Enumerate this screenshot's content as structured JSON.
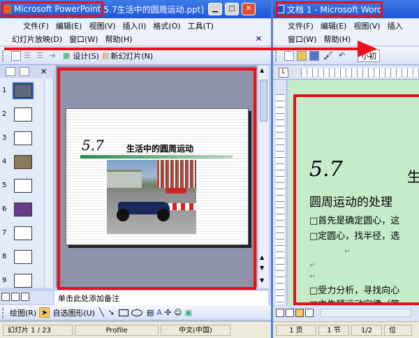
{
  "ppt": {
    "app_title": "Microsoft PowerPoint",
    "doc_title": "5.7生活中的圆周运动.ppt]",
    "menu_row1": [
      "文件(F)",
      "编辑(E)",
      "视图(V)",
      "插入(I)",
      "格式(O)",
      "工具(T)"
    ],
    "menu_row2": [
      "幻灯片放映(D)",
      "窗口(W)",
      "帮助(H)"
    ],
    "toolbar": {
      "design": "设计(S)",
      "new_slide": "新幻灯片(N)"
    },
    "slide_numbers": [
      "1",
      "2",
      "3",
      "4",
      "5",
      "6",
      "7",
      "8",
      "9"
    ],
    "slide": {
      "number": "5.7",
      "title": "生活中的圆周运动"
    },
    "notes_placeholder": "单击此处添加备注",
    "drawing": {
      "draw": "绘图(R)",
      "autoshape": "自选图形(U)"
    },
    "status": {
      "slide_pos": "幻灯片 1 / 23",
      "template": "Profile",
      "language": "中文(中国)"
    }
  },
  "word": {
    "title": "文档 1 - Microsoft Word",
    "menu_row1": [
      "文件(F)",
      "编辑(E)",
      "视图(V)",
      "插入"
    ],
    "menu_row2": [
      "窗口(W)",
      "帮助(H)"
    ],
    "font_size": "小初",
    "doc": {
      "number": "5.7",
      "title_char": "生",
      "heading": "圆周运动的处理",
      "line1": "□首先是确定圆心，这",
      "line2": "□定圆心，找半径，选",
      "line3": "□受力分析，寻找向心",
      "line4": "□由牛顿运动定律（第"
    },
    "status": {
      "page": "1 页",
      "section": "1 节",
      "pages": "1/2",
      "pos": "位"
    }
  }
}
